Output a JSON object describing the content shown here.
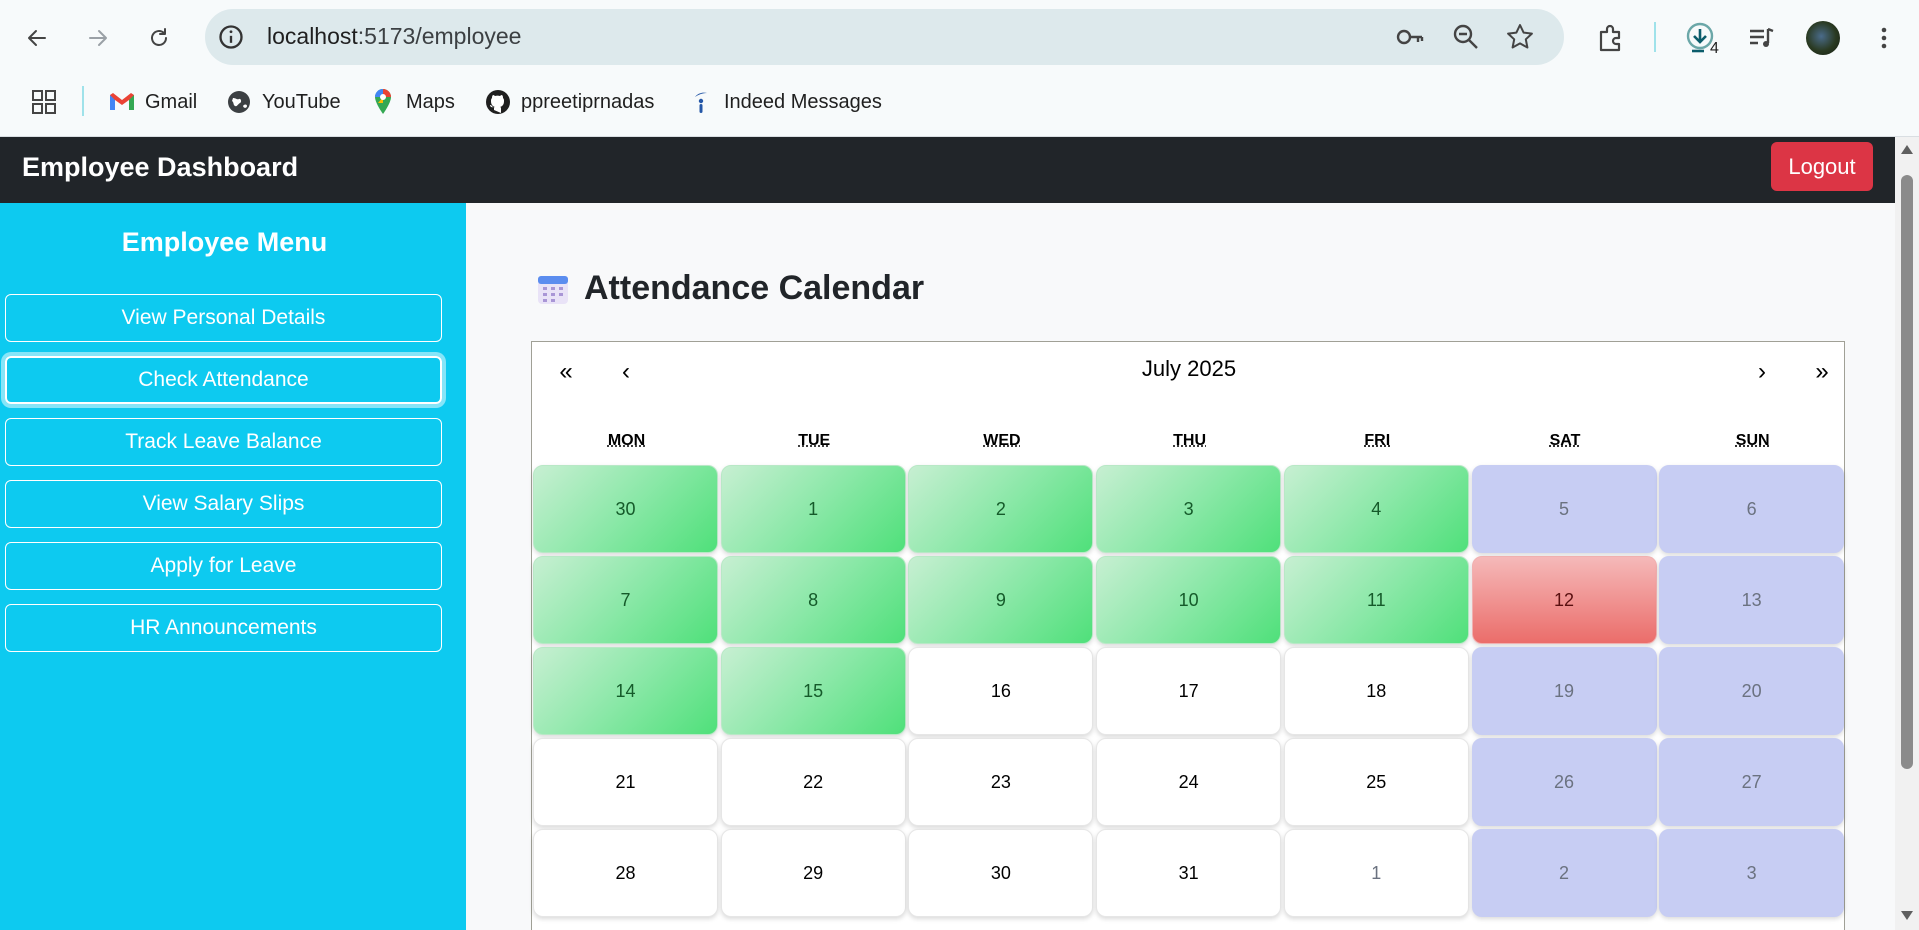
{
  "browser": {
    "url_host": "localhost",
    "url_port_path": ":5173/employee",
    "download_count": "4",
    "bookmarks": [
      {
        "label": "Gmail",
        "icon": "gmail-icon"
      },
      {
        "label": "YouTube",
        "icon": "globe-icon"
      },
      {
        "label": "Maps",
        "icon": "maps-pin-icon"
      },
      {
        "label": "ppreetiprnadas",
        "icon": "github-icon"
      },
      {
        "label": "Indeed Messages",
        "icon": "indeed-icon"
      }
    ]
  },
  "app": {
    "title": "Employee Dashboard",
    "logout_label": "Logout"
  },
  "sidebar": {
    "title": "Employee Menu",
    "items": [
      {
        "label": "View Personal Details",
        "active": false
      },
      {
        "label": "Check Attendance",
        "active": true
      },
      {
        "label": "Track Leave Balance",
        "active": false
      },
      {
        "label": "View Salary Slips",
        "active": false
      },
      {
        "label": "Apply for Leave",
        "active": false
      },
      {
        "label": "HR Announcements",
        "active": false
      }
    ]
  },
  "calendar": {
    "heading": "Attendance Calendar",
    "month_label": "July 2025",
    "nav": {
      "prev2": "«",
      "prev": "‹",
      "next": "›",
      "next2": "»"
    },
    "weekdays": [
      "MON",
      "TUE",
      "WED",
      "THU",
      "FRI",
      "SAT",
      "SUN"
    ],
    "weeks": [
      [
        {
          "d": "30",
          "s": "present"
        },
        {
          "d": "1",
          "s": "present"
        },
        {
          "d": "2",
          "s": "present"
        },
        {
          "d": "3",
          "s": "present"
        },
        {
          "d": "4",
          "s": "present"
        },
        {
          "d": "5",
          "s": "weekend"
        },
        {
          "d": "6",
          "s": "weekend"
        }
      ],
      [
        {
          "d": "7",
          "s": "present"
        },
        {
          "d": "8",
          "s": "present"
        },
        {
          "d": "9",
          "s": "present"
        },
        {
          "d": "10",
          "s": "present"
        },
        {
          "d": "11",
          "s": "present"
        },
        {
          "d": "12",
          "s": "absent"
        },
        {
          "d": "13",
          "s": "weekend"
        }
      ],
      [
        {
          "d": "14",
          "s": "present"
        },
        {
          "d": "15",
          "s": "present"
        },
        {
          "d": "16",
          "s": "none"
        },
        {
          "d": "17",
          "s": "none"
        },
        {
          "d": "18",
          "s": "none"
        },
        {
          "d": "19",
          "s": "weekend"
        },
        {
          "d": "20",
          "s": "weekend"
        }
      ],
      [
        {
          "d": "21",
          "s": "none"
        },
        {
          "d": "22",
          "s": "none"
        },
        {
          "d": "23",
          "s": "none"
        },
        {
          "d": "24",
          "s": "none"
        },
        {
          "d": "25",
          "s": "none"
        },
        {
          "d": "26",
          "s": "weekend"
        },
        {
          "d": "27",
          "s": "weekend"
        }
      ],
      [
        {
          "d": "28",
          "s": "none"
        },
        {
          "d": "29",
          "s": "none"
        },
        {
          "d": "30",
          "s": "none"
        },
        {
          "d": "31",
          "s": "none"
        },
        {
          "d": "1",
          "s": "neighbor"
        },
        {
          "d": "2",
          "s": "weekend"
        },
        {
          "d": "3",
          "s": "weekend"
        }
      ]
    ]
  },
  "colors": {
    "navbar": "#212529",
    "sidebar": "#0dcaf0",
    "logout": "#dc3545",
    "present": "#4fe07a",
    "absent": "#eb6d6a",
    "weekend": "#c7cdf3"
  }
}
